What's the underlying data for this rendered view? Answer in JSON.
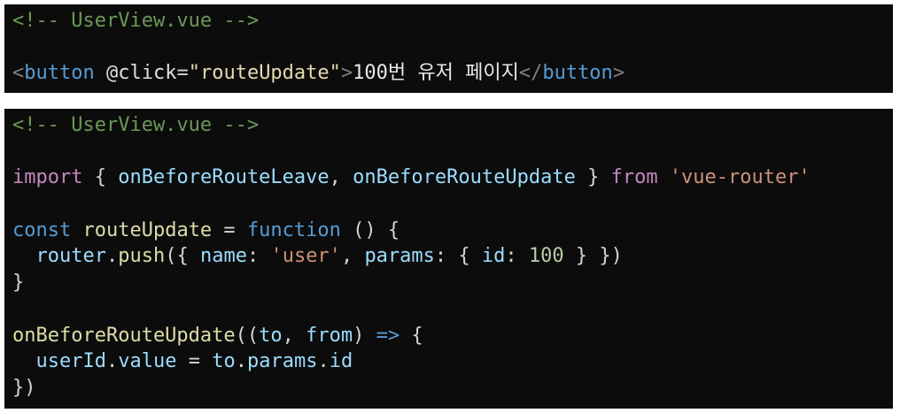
{
  "code_blocks": [
    {
      "lines": [
        [
          {
            "t": "<!-- UserView.vue -->",
            "c": "#6A9955"
          }
        ],
        [],
        [
          {
            "t": "<",
            "c": "#808080"
          },
          {
            "t": "button",
            "c": "#569CD6"
          },
          {
            "t": " ",
            "c": "#D4D4D4"
          },
          {
            "t": "@click",
            "c": "#E0E0E0"
          },
          {
            "t": "=",
            "c": "#D4D4D4"
          },
          {
            "t": "\"routeUpdate\"",
            "c": "#E5DBB0"
          },
          {
            "t": ">",
            "c": "#808080"
          },
          {
            "t": "100번 유저 페이지",
            "c": "#E8E8E8"
          },
          {
            "t": "</",
            "c": "#808080"
          },
          {
            "t": "button",
            "c": "#569CD6"
          },
          {
            "t": ">",
            "c": "#808080"
          }
        ]
      ]
    },
    {
      "lines": [
        [
          {
            "t": "<!-- UserView.vue -->",
            "c": "#6A9955"
          }
        ],
        [],
        [
          {
            "t": "import",
            "c": "#C586C0"
          },
          {
            "t": " { ",
            "c": "#D4D4D4"
          },
          {
            "t": "onBeforeRouteLeave",
            "c": "#9CDCFE"
          },
          {
            "t": ", ",
            "c": "#D4D4D4"
          },
          {
            "t": "onBeforeRouteUpdate",
            "c": "#9CDCFE"
          },
          {
            "t": " } ",
            "c": "#D4D4D4"
          },
          {
            "t": "from",
            "c": "#C586C0"
          },
          {
            "t": " ",
            "c": "#D4D4D4"
          },
          {
            "t": "'vue-router'",
            "c": "#CE9178"
          }
        ],
        [],
        [
          {
            "t": "const",
            "c": "#569CD6"
          },
          {
            "t": " ",
            "c": "#D4D4D4"
          },
          {
            "t": "routeUpdate",
            "c": "#DCDCAA"
          },
          {
            "t": " = ",
            "c": "#D4D4D4"
          },
          {
            "t": "function",
            "c": "#569CD6"
          },
          {
            "t": " () {",
            "c": "#D4D4D4"
          }
        ],
        [
          {
            "t": "  ",
            "c": "#D4D4D4"
          },
          {
            "t": "router",
            "c": "#9CDCFE"
          },
          {
            "t": ".",
            "c": "#D4D4D4"
          },
          {
            "t": "push",
            "c": "#DCDCAA"
          },
          {
            "t": "({ ",
            "c": "#D4D4D4"
          },
          {
            "t": "name",
            "c": "#9CDCFE"
          },
          {
            "t": ": ",
            "c": "#D4D4D4"
          },
          {
            "t": "'user'",
            "c": "#CE9178"
          },
          {
            "t": ", ",
            "c": "#D4D4D4"
          },
          {
            "t": "params",
            "c": "#9CDCFE"
          },
          {
            "t": ": { ",
            "c": "#D4D4D4"
          },
          {
            "t": "id",
            "c": "#9CDCFE"
          },
          {
            "t": ": ",
            "c": "#D4D4D4"
          },
          {
            "t": "100",
            "c": "#B5CEA8"
          },
          {
            "t": " } })",
            "c": "#D4D4D4"
          }
        ],
        [
          {
            "t": "}",
            "c": "#D4D4D4"
          }
        ],
        [],
        [
          {
            "t": "onBeforeRouteUpdate",
            "c": "#DCDCAA"
          },
          {
            "t": "((",
            "c": "#D4D4D4"
          },
          {
            "t": "to",
            "c": "#9CDCFE"
          },
          {
            "t": ", ",
            "c": "#D4D4D4"
          },
          {
            "t": "from",
            "c": "#9CDCFE"
          },
          {
            "t": ") ",
            "c": "#D4D4D4"
          },
          {
            "t": "=>",
            "c": "#569CD6"
          },
          {
            "t": " {",
            "c": "#D4D4D4"
          }
        ],
        [
          {
            "t": "  ",
            "c": "#D4D4D4"
          },
          {
            "t": "userId",
            "c": "#9CDCFE"
          },
          {
            "t": ".",
            "c": "#D4D4D4"
          },
          {
            "t": "value",
            "c": "#9CDCFE"
          },
          {
            "t": " = ",
            "c": "#D4D4D4"
          },
          {
            "t": "to",
            "c": "#9CDCFE"
          },
          {
            "t": ".",
            "c": "#D4D4D4"
          },
          {
            "t": "params",
            "c": "#9CDCFE"
          },
          {
            "t": ".",
            "c": "#D4D4D4"
          },
          {
            "t": "id",
            "c": "#9CDCFE"
          }
        ],
        [
          {
            "t": "})",
            "c": "#D4D4D4"
          }
        ]
      ]
    }
  ]
}
